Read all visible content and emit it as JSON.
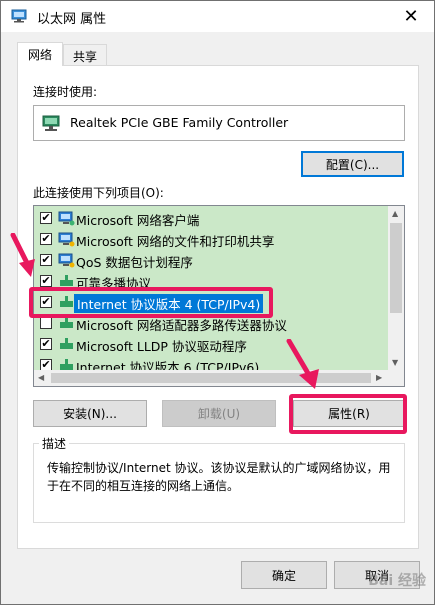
{
  "window": {
    "title": "以太网 属性",
    "close_glyph": "✕"
  },
  "tabs": [
    {
      "label": "网络",
      "active": true
    },
    {
      "label": "共享",
      "active": false
    }
  ],
  "connect_using": {
    "label": "连接时使用:",
    "adapter": "Realtek PCIe GBE Family Controller",
    "configure_button": "配置(C)..."
  },
  "items_section": {
    "label": "此连接使用下列项目(O):",
    "items": [
      {
        "label": "Microsoft 网络客户端",
        "checked": true,
        "icon": "network-client-icon"
      },
      {
        "label": "Microsoft 网络的文件和打印机共享",
        "checked": true,
        "icon": "network-service-icon"
      },
      {
        "label": "QoS 数据包计划程序",
        "checked": true,
        "icon": "network-service-icon"
      },
      {
        "label": "可靠多播协议",
        "checked": true,
        "icon": "protocol-icon"
      },
      {
        "label": "Internet 协议版本 4 (TCP/IPv4)",
        "checked": true,
        "icon": "protocol-icon",
        "selected": true
      },
      {
        "label": "Microsoft 网络适配器多路传送器协议",
        "checked": false,
        "icon": "protocol-icon"
      },
      {
        "label": "Microsoft LLDP 协议驱动程序",
        "checked": true,
        "icon": "protocol-icon"
      },
      {
        "label": "Internet 协议版本 6 (TCP/IPv6)",
        "checked": true,
        "icon": "protocol-icon"
      }
    ]
  },
  "buttons": {
    "install": "安装(N)...",
    "uninstall": "卸载(U)",
    "properties": "属性(R)",
    "ok": "确定",
    "cancel": "取消"
  },
  "description": {
    "title": "描述",
    "text": "传输控制协议/Internet 协议。该协议是默认的广域网络协议，用于在不同的相互连接的网络上通信。"
  },
  "watermark": "Bai 经验",
  "colors": {
    "accent": "#0078d7",
    "highlight": "#e8185e",
    "list_bg": "#cbe8c8"
  }
}
